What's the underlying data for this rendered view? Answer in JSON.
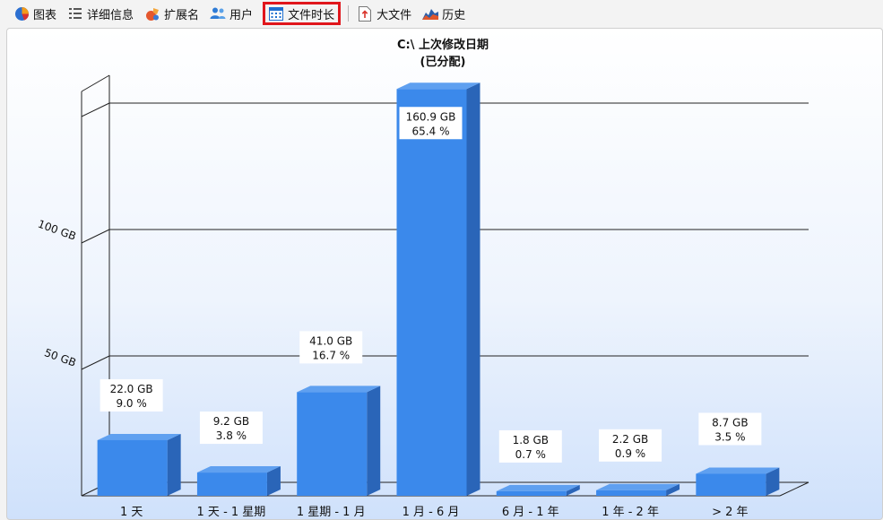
{
  "toolbar": {
    "tabs": [
      {
        "label": "图表",
        "icon": "pie-chart-icon"
      },
      {
        "label": "详细信息",
        "icon": "details-list-icon"
      },
      {
        "label": "扩展名",
        "icon": "extension-icon"
      },
      {
        "label": "用户",
        "icon": "users-icon"
      },
      {
        "label": "文件时长",
        "icon": "calendar-icon",
        "active": true
      },
      {
        "label": "大文件",
        "icon": "large-file-icon"
      },
      {
        "label": "历史",
        "icon": "history-icon"
      }
    ]
  },
  "colors": {
    "accent_highlight": "#e0161c",
    "bar_front": "#3b89eb",
    "bar_top": "#5fa0f0",
    "bar_side": "#2a65b8"
  },
  "chart_data": {
    "type": "bar",
    "title": "C:\\ 上次修改日期",
    "subtitle": "(已分配)",
    "categories": [
      "1 天",
      "1 天 - 1 星期",
      "1 星期 - 1 月",
      "1 月 - 6 月",
      "6 月 - 1 年",
      "1 年 - 2 年",
      "> 2 年"
    ],
    "values": [
      22.0,
      9.2,
      41.0,
      160.9,
      1.8,
      2.2,
      8.7
    ],
    "data_labels": [
      "22.0 GB",
      "9.2 GB",
      "41.0 GB",
      "160.9 GB",
      "1.8 GB",
      "2.2 GB",
      "8.7 GB"
    ],
    "percent_labels": [
      "9.0 %",
      "3.8 %",
      "16.7 %",
      "65.4 %",
      "0.7 %",
      "0.9 %",
      "3.5 %"
    ],
    "yticks": [
      {
        "value": 50,
        "label": "50 GB"
      },
      {
        "value": 100,
        "label": "100 GB"
      },
      {
        "value": 150,
        "label": ""
      }
    ],
    "ylabel": "",
    "xlabel": "",
    "grid": true,
    "legend": "none"
  }
}
